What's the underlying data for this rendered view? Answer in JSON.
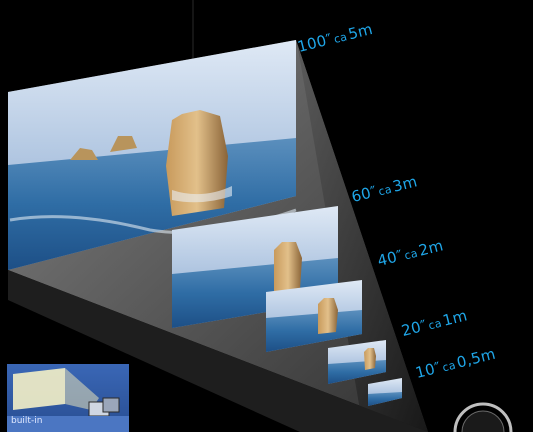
{
  "labels": [
    {
      "size": "100″",
      "ca": "ca",
      "dist": "5m"
    },
    {
      "size": "60″",
      "ca": "ca",
      "dist": "3m"
    },
    {
      "size": "40″",
      "ca": "ca",
      "dist": "2m"
    },
    {
      "size": "20″",
      "ca": "ca",
      "dist": "1m"
    },
    {
      "size": "10″",
      "ca": "ca",
      "dist": "0,5m"
    }
  ],
  "thumbnail": {
    "text": "built-in"
  },
  "colors": {
    "label": "#1fa6e8",
    "background": "#000000"
  }
}
